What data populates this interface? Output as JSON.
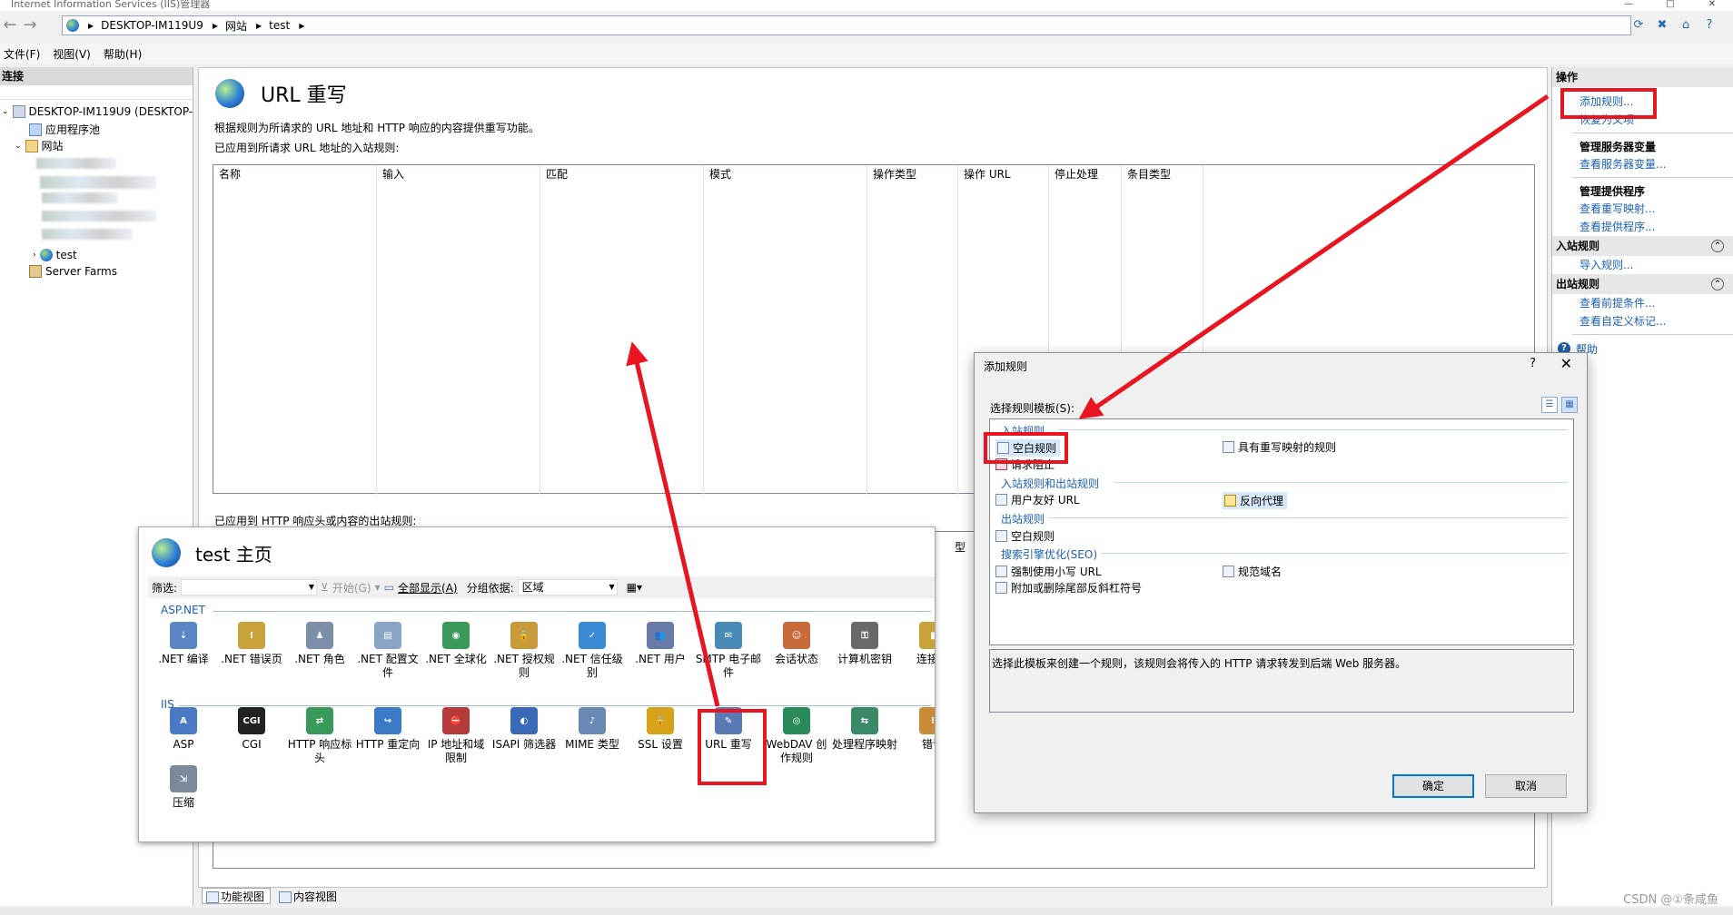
{
  "window": {
    "title": "Internet Information Services (IIS)管理器"
  },
  "address": {
    "crumbs": [
      "DESKTOP-IM119U9",
      "网站",
      "test"
    ]
  },
  "menu": [
    "文件(F)",
    "视图(V)",
    "帮助(H)"
  ],
  "connections": {
    "header": "连接",
    "tree": {
      "server": "DESKTOP-IM119U9 (DESKTOP-",
      "app_pools": "应用程序池",
      "sites": "网站",
      "site_test": "test",
      "server_farms": "Server Farms"
    }
  },
  "main": {
    "title": "URL 重写",
    "description": "根据规则为所请求的 URL 地址和 HTTP 响应的内容提供重写功能。",
    "inbound_caption": "已应用到所请求 URL 地址的入站规则:",
    "columns": [
      "名称",
      "输入",
      "匹配",
      "模式",
      "操作类型",
      "操作 URL",
      "停止处理",
      "条目类型"
    ],
    "outbound_caption": "已应用到 HTTP 响应头或内容的出站规则:",
    "outbound_partial_column": "型"
  },
  "bottom_tabs": [
    "功能视图",
    "内容视图"
  ],
  "actions": {
    "header": "操作",
    "add_rule": "添加规则...",
    "revert_parent": "恢复为父项",
    "manage_server_vars": "管理服务器变量",
    "view_server_vars": "查看服务器变量...",
    "manage_providers": "管理提供程序",
    "view_rewrite_maps": "查看重写映射...",
    "view_providers": "查看提供程序...",
    "inbound_rules": "入站规则",
    "import_rules": "导入规则...",
    "outbound_rules": "出站规则",
    "view_preconditions": "查看前提条件...",
    "view_custom_tags": "查看自定义标记...",
    "help": "帮助"
  },
  "home": {
    "title": "test 主页",
    "filter_label": "筛选:",
    "start_btn": "开始(G)",
    "show_all": "全部显示(A)",
    "group_by_label": "分组依据:",
    "group_by_value": "区域",
    "aspnet_label": "ASP.NET",
    "iis_label": "IIS",
    "aspnet_items": [
      ".NET 编译",
      ".NET 错误页",
      ".NET 角色",
      ".NET 配置文件",
      ".NET 全球化",
      ".NET 授权规则",
      ".NET 信任级别",
      ".NET 用户",
      "SMTP 电子邮件",
      "会话状态",
      "计算机密钥",
      "连接字"
    ],
    "iis_items": [
      "ASP",
      "CGI",
      "HTTP 响应标头",
      "HTTP 重定向",
      "IP 地址和域限制",
      "ISAPI 筛选器",
      "MIME 类型",
      "SSL 设置",
      "URL 重写",
      "WebDAV 创作规则",
      "处理程序映射",
      "错误"
    ],
    "extra_items": [
      "压缩"
    ]
  },
  "dialog": {
    "title": "添加规则",
    "question": "?",
    "select_label": "选择规则模板(S):",
    "groups": {
      "inbound": "入站规则",
      "in_out": "入站规则和出站规则",
      "outbound": "出站规则",
      "seo": "搜索引擎优化(SEO)"
    },
    "items": {
      "blank_rule": "空白规则",
      "with_map": "具有重写映射的规则",
      "request_block": "请求阻止",
      "friendly_url": "用户友好 URL",
      "reverse_proxy": "反向代理",
      "out_blank": "空白规则",
      "lowercase": "强制使用小写 URL",
      "canonical": "规范域名",
      "trailing_slash": "附加或删除尾部反斜杠符号"
    },
    "description": "选择此模板来创建一个规则，该规则会将传入的 HTTP 请求转发到后端 Web 服务器。",
    "ok": "确定",
    "cancel": "取消"
  },
  "watermark": "CSDN @①条咸鱼",
  "colors": {
    "accent": "#1a5fb4",
    "annotation": "#e8141f"
  }
}
